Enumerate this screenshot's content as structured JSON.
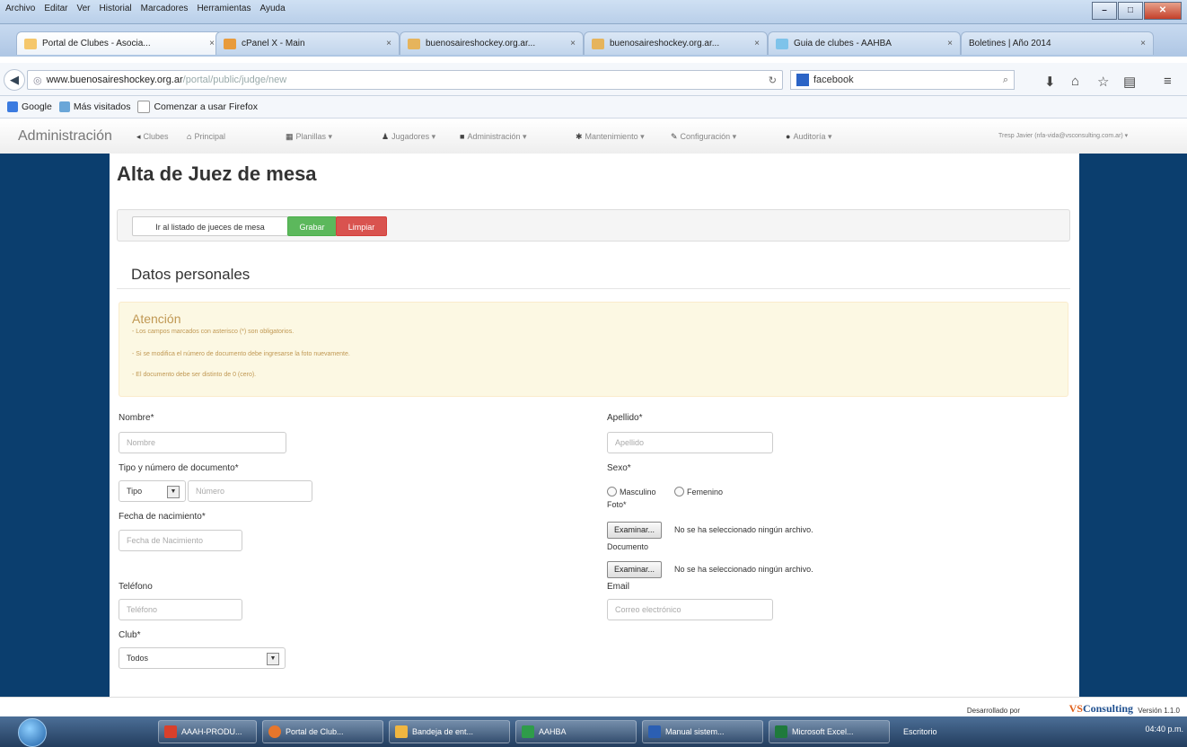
{
  "browser": {
    "menu": [
      "Archivo",
      "Editar",
      "Ver",
      "Historial",
      "Marcadores",
      "Herramientas",
      "Ayuda"
    ],
    "tabs": [
      {
        "title": "Portal de Clubes - Asocia...",
        "close": "×"
      },
      {
        "title": "cPanel X - Main",
        "close": "×"
      },
      {
        "title": "buenosaireshockey.org.ar...",
        "close": "×"
      },
      {
        "title": "buenosaireshockey.org.ar...",
        "close": "×"
      },
      {
        "title": "Guia de clubes - AAHBA",
        "close": "×"
      },
      {
        "title": "Boletines | Año 2014",
        "close": "×"
      }
    ],
    "url_host": "www.buenosaireshockey.org.ar",
    "url_path": "/portal/public/judge/new",
    "search_value": "facebook",
    "bookmarks": [
      "Google",
      "Más visitados",
      "Comenzar a usar Firefox"
    ]
  },
  "appnav": {
    "brand": "Administración",
    "items": [
      "Clubes",
      "Principal",
      "Planillas",
      "Jugadores",
      "Administración",
      "Mantenimiento",
      "Configuración",
      "Auditoría"
    ],
    "user": "Tresp Javier (nfa-vida@vsconsulting.com.ar)"
  },
  "page": {
    "title": "Alta de Juez de mesa",
    "buttons": {
      "list": "Ir al listado de jueces de mesa",
      "save": "Grabar",
      "clear": "Limpiar"
    },
    "section": "Datos personales",
    "alert": {
      "title": "Atención",
      "lines": [
        "- Los campos marcados con asterisco (*) son obligatorios.",
        "- Si se modifica el número de documento debe ingresarse la foto nuevamente.",
        "- El documento debe ser distinto de 0 (cero)."
      ]
    }
  },
  "form": {
    "nombre": {
      "label": "Nombre*",
      "placeholder": "Nombre"
    },
    "apellido": {
      "label": "Apellido*",
      "placeholder": "Apellido"
    },
    "documento": {
      "label": "Tipo y número de documento*",
      "tipo": "Tipo",
      "placeholder": "Número"
    },
    "sexo": {
      "label": "Sexo*",
      "options": [
        "Masculino",
        "Femenino"
      ]
    },
    "nacimiento": {
      "label": "Fecha de nacimiento*",
      "placeholder": "Fecha de Nacimiento"
    },
    "foto": {
      "label": "Foto*",
      "button": "Examinar...",
      "status": "No se ha seleccionado ningún archivo."
    },
    "doc_file": {
      "label": "Documento",
      "button": "Examinar...",
      "status": "No se ha seleccionado ningún archivo."
    },
    "telefono": {
      "label": "Teléfono",
      "placeholder": "Teléfono"
    },
    "email": {
      "label": "Email",
      "placeholder": "Correo electrónico"
    },
    "club": {
      "label": "Club*",
      "value": "Todos"
    }
  },
  "footer": {
    "dev": "Desarrollado por",
    "logo_a": "VS",
    "logo_b": "Consulting",
    "version": "Versión 1.1.0"
  },
  "taskbar": {
    "items": [
      "AAAH-PRODU...",
      "Portal de Club...",
      "Bandeja de ent...",
      "AAHBA",
      "Manual sistem...",
      "Microsoft Excel..."
    ],
    "desk": "Escritorio",
    "time": "04:40 p.m."
  },
  "colors": {
    "side_panel": "#0b3e6e",
    "success": "#5cb85c",
    "danger": "#d9534f",
    "alert_bg": "#fcf8e3"
  }
}
